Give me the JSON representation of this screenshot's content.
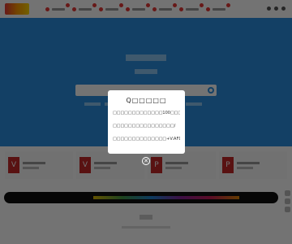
{
  "modal": {
    "title": "Q□□□□□",
    "lines": [
      "□□□□□□□□□□□□□100□□□98",
      "□□□□□□□□□□□□□□□□/",
      "□□□□□□□□□□□□□□+V:AFD8585"
    ]
  },
  "icons": {
    "close": "✕",
    "card_icons": [
      "V",
      "V",
      "P",
      "P"
    ]
  },
  "colors": {
    "hero": "#2a8ee0",
    "accent": "#e53935",
    "overlay": "rgba(0,0,0,0.55)"
  }
}
